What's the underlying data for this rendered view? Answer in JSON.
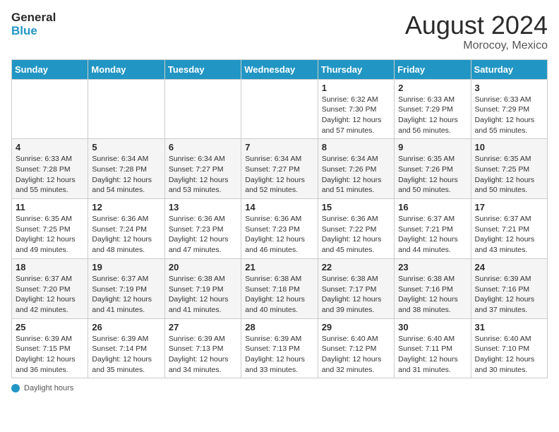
{
  "header": {
    "logo_line1": "General",
    "logo_line2": "Blue",
    "month_year": "August 2024",
    "location": "Morocoy, Mexico"
  },
  "days_of_week": [
    "Sunday",
    "Monday",
    "Tuesday",
    "Wednesday",
    "Thursday",
    "Friday",
    "Saturday"
  ],
  "weeks": [
    [
      {
        "day": "",
        "info": ""
      },
      {
        "day": "",
        "info": ""
      },
      {
        "day": "",
        "info": ""
      },
      {
        "day": "",
        "info": ""
      },
      {
        "day": "1",
        "info": "Sunrise: 6:32 AM\nSunset: 7:30 PM\nDaylight: 12 hours and 57 minutes."
      },
      {
        "day": "2",
        "info": "Sunrise: 6:33 AM\nSunset: 7:29 PM\nDaylight: 12 hours and 56 minutes."
      },
      {
        "day": "3",
        "info": "Sunrise: 6:33 AM\nSunset: 7:29 PM\nDaylight: 12 hours and 55 minutes."
      }
    ],
    [
      {
        "day": "4",
        "info": "Sunrise: 6:33 AM\nSunset: 7:28 PM\nDaylight: 12 hours and 55 minutes."
      },
      {
        "day": "5",
        "info": "Sunrise: 6:34 AM\nSunset: 7:28 PM\nDaylight: 12 hours and 54 minutes."
      },
      {
        "day": "6",
        "info": "Sunrise: 6:34 AM\nSunset: 7:27 PM\nDaylight: 12 hours and 53 minutes."
      },
      {
        "day": "7",
        "info": "Sunrise: 6:34 AM\nSunset: 7:27 PM\nDaylight: 12 hours and 52 minutes."
      },
      {
        "day": "8",
        "info": "Sunrise: 6:34 AM\nSunset: 7:26 PM\nDaylight: 12 hours and 51 minutes."
      },
      {
        "day": "9",
        "info": "Sunrise: 6:35 AM\nSunset: 7:26 PM\nDaylight: 12 hours and 50 minutes."
      },
      {
        "day": "10",
        "info": "Sunrise: 6:35 AM\nSunset: 7:25 PM\nDaylight: 12 hours and 50 minutes."
      }
    ],
    [
      {
        "day": "11",
        "info": "Sunrise: 6:35 AM\nSunset: 7:25 PM\nDaylight: 12 hours and 49 minutes."
      },
      {
        "day": "12",
        "info": "Sunrise: 6:36 AM\nSunset: 7:24 PM\nDaylight: 12 hours and 48 minutes."
      },
      {
        "day": "13",
        "info": "Sunrise: 6:36 AM\nSunset: 7:23 PM\nDaylight: 12 hours and 47 minutes."
      },
      {
        "day": "14",
        "info": "Sunrise: 6:36 AM\nSunset: 7:23 PM\nDaylight: 12 hours and 46 minutes."
      },
      {
        "day": "15",
        "info": "Sunrise: 6:36 AM\nSunset: 7:22 PM\nDaylight: 12 hours and 45 minutes."
      },
      {
        "day": "16",
        "info": "Sunrise: 6:37 AM\nSunset: 7:21 PM\nDaylight: 12 hours and 44 minutes."
      },
      {
        "day": "17",
        "info": "Sunrise: 6:37 AM\nSunset: 7:21 PM\nDaylight: 12 hours and 43 minutes."
      }
    ],
    [
      {
        "day": "18",
        "info": "Sunrise: 6:37 AM\nSunset: 7:20 PM\nDaylight: 12 hours and 42 minutes."
      },
      {
        "day": "19",
        "info": "Sunrise: 6:37 AM\nSunset: 7:19 PM\nDaylight: 12 hours and 41 minutes."
      },
      {
        "day": "20",
        "info": "Sunrise: 6:38 AM\nSunset: 7:19 PM\nDaylight: 12 hours and 41 minutes."
      },
      {
        "day": "21",
        "info": "Sunrise: 6:38 AM\nSunset: 7:18 PM\nDaylight: 12 hours and 40 minutes."
      },
      {
        "day": "22",
        "info": "Sunrise: 6:38 AM\nSunset: 7:17 PM\nDaylight: 12 hours and 39 minutes."
      },
      {
        "day": "23",
        "info": "Sunrise: 6:38 AM\nSunset: 7:16 PM\nDaylight: 12 hours and 38 minutes."
      },
      {
        "day": "24",
        "info": "Sunrise: 6:39 AM\nSunset: 7:16 PM\nDaylight: 12 hours and 37 minutes."
      }
    ],
    [
      {
        "day": "25",
        "info": "Sunrise: 6:39 AM\nSunset: 7:15 PM\nDaylight: 12 hours and 36 minutes."
      },
      {
        "day": "26",
        "info": "Sunrise: 6:39 AM\nSunset: 7:14 PM\nDaylight: 12 hours and 35 minutes."
      },
      {
        "day": "27",
        "info": "Sunrise: 6:39 AM\nSunset: 7:13 PM\nDaylight: 12 hours and 34 minutes."
      },
      {
        "day": "28",
        "info": "Sunrise: 6:39 AM\nSunset: 7:13 PM\nDaylight: 12 hours and 33 minutes."
      },
      {
        "day": "29",
        "info": "Sunrise: 6:40 AM\nSunset: 7:12 PM\nDaylight: 12 hours and 32 minutes."
      },
      {
        "day": "30",
        "info": "Sunrise: 6:40 AM\nSunset: 7:11 PM\nDaylight: 12 hours and 31 minutes."
      },
      {
        "day": "31",
        "info": "Sunrise: 6:40 AM\nSunset: 7:10 PM\nDaylight: 12 hours and 30 minutes."
      }
    ]
  ],
  "footer": {
    "daylight_label": "Daylight hours"
  }
}
